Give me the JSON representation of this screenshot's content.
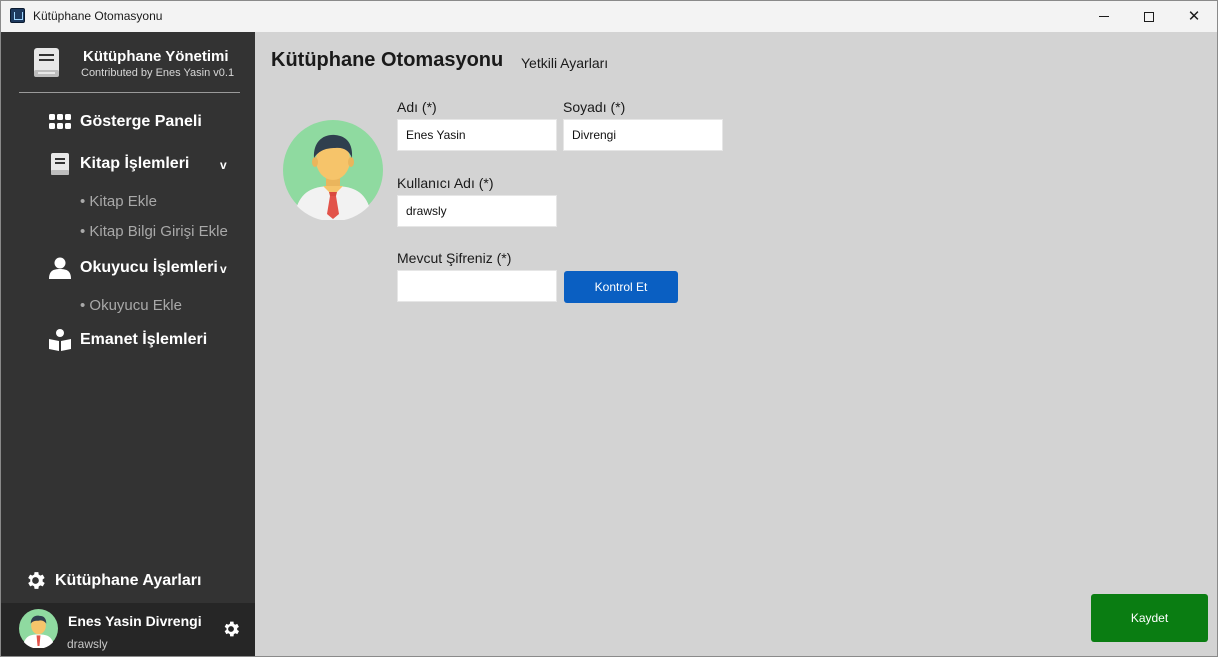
{
  "window": {
    "title": "Kütüphane Otomasyonu",
    "icon": "app-book-icon",
    "controls": [
      "minimize-icon",
      "maximize-icon",
      "close-icon"
    ]
  },
  "sidebar": {
    "brand": {
      "icon": "book-icon",
      "title": "Kütüphane Yönetimi",
      "subtitle": "Contributed by Enes Yasin v0.1"
    },
    "items": [
      {
        "icon": "grid-icon",
        "label": "Gösterge Paneli"
      },
      {
        "icon": "book-icon",
        "label": "Kitap İşlemleri",
        "chevron": "v",
        "subitems": [
          "• Kitap Ekle",
          "• Kitap Bilgi Girişi Ekle"
        ]
      },
      {
        "icon": "user-icon",
        "label": "Okuyucu İşlemleri",
        "chevron": "v",
        "subitems": [
          "• Okuyucu Ekle"
        ]
      },
      {
        "icon": "reader-icon",
        "label": "Emanet İşlemleri"
      }
    ],
    "settings": {
      "icon": "gear-icon",
      "label": "Kütüphane Ayarları"
    },
    "user": {
      "name": "Enes Yasin Divrengi",
      "username": "drawsly",
      "avatar": "user-avatar",
      "action_icon": "gear-icon"
    }
  },
  "main": {
    "title": "Kütüphane Otomasyonu",
    "subtitle": "Yetkili Ayarları",
    "avatar": "profile-avatar",
    "form": {
      "first_name_label": "Adı (*)",
      "first_name_value": "Enes Yasin",
      "last_name_label": "Soyadı (*)",
      "last_name_value": "Divrengi",
      "username_label": "Kullanıcı Adı (*)",
      "username_value": "drawsly",
      "password_label": "Mevcut Şifreniz (*)",
      "password_value": "",
      "check_button": "Kontrol Et"
    },
    "save_button": "Kaydet"
  },
  "colors": {
    "sidebar_bg": "#333333",
    "content_bg": "#d3d3d3",
    "check_button": "#0a5fc2",
    "save_button": "#0a7d12"
  }
}
